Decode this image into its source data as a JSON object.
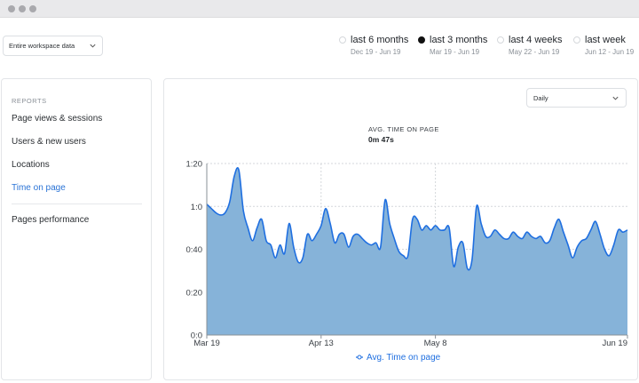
{
  "window": {
    "controls": [
      "close",
      "minimize",
      "maximize"
    ]
  },
  "workspace_filter": {
    "value": "Entire workspace data"
  },
  "periods": [
    {
      "label": "last 6 months",
      "range": "Dec 19 - Jun 19",
      "selected": false
    },
    {
      "label": "last 3 months",
      "range": "Mar 19 - Jun 19",
      "selected": true
    },
    {
      "label": "last 4 weeks",
      "range": "May 22 - Jun 19",
      "selected": false
    },
    {
      "label": "last week",
      "range": "Jun 12 - Jun 19",
      "selected": false
    }
  ],
  "sidebar": {
    "heading": "REPORTS",
    "items": [
      {
        "label": "Page views & sessions",
        "active": false
      },
      {
        "label": "Users & new users",
        "active": false
      },
      {
        "label": "Locations",
        "active": false
      },
      {
        "label": "Time on page",
        "active": true
      },
      {
        "label": "Pages performance",
        "active": false
      }
    ]
  },
  "granularity": {
    "value": "Daily"
  },
  "summary": {
    "label": "AVG. TIME ON PAGE",
    "value": "0m 47s"
  },
  "chart_data": {
    "type": "area",
    "ylabel": "",
    "xlabel": "",
    "yticks": [
      "0:0",
      "0:20",
      "0:40",
      "1:0",
      "1:20"
    ],
    "ylim": [
      0,
      80
    ],
    "xticks": [
      {
        "label": "Mar 19",
        "day": 0
      },
      {
        "label": "Apr 13",
        "day": 25
      },
      {
        "label": "May 8",
        "day": 50
      },
      {
        "label": "Jun 19",
        "day": 92
      }
    ],
    "series": [
      {
        "name": "Avg. Time on page",
        "color": "#1f6fe0",
        "fill": "#86b3d9",
        "values": [
          61,
          59,
          57,
          56,
          57,
          62,
          74,
          77,
          58,
          50,
          44,
          50,
          54,
          44,
          42,
          36,
          42,
          38,
          52,
          41,
          34,
          36,
          47,
          44,
          47,
          51,
          59,
          52,
          43,
          47,
          47,
          41,
          46,
          47,
          45,
          43,
          42,
          43,
          41,
          63,
          52,
          45,
          39,
          37,
          37,
          54,
          54,
          49,
          51,
          49,
          51,
          49,
          49,
          50,
          32,
          41,
          43,
          31,
          35,
          60,
          52,
          46,
          46,
          49,
          47,
          45,
          45,
          48,
          46,
          45,
          48,
          46,
          45,
          46,
          43,
          44,
          50,
          54,
          48,
          42,
          36,
          41,
          44,
          45,
          49,
          53,
          47,
          40,
          37,
          42,
          49,
          48,
          49
        ]
      }
    ],
    "grid": {
      "y": true,
      "x": true
    },
    "legend": "bottom-center"
  }
}
